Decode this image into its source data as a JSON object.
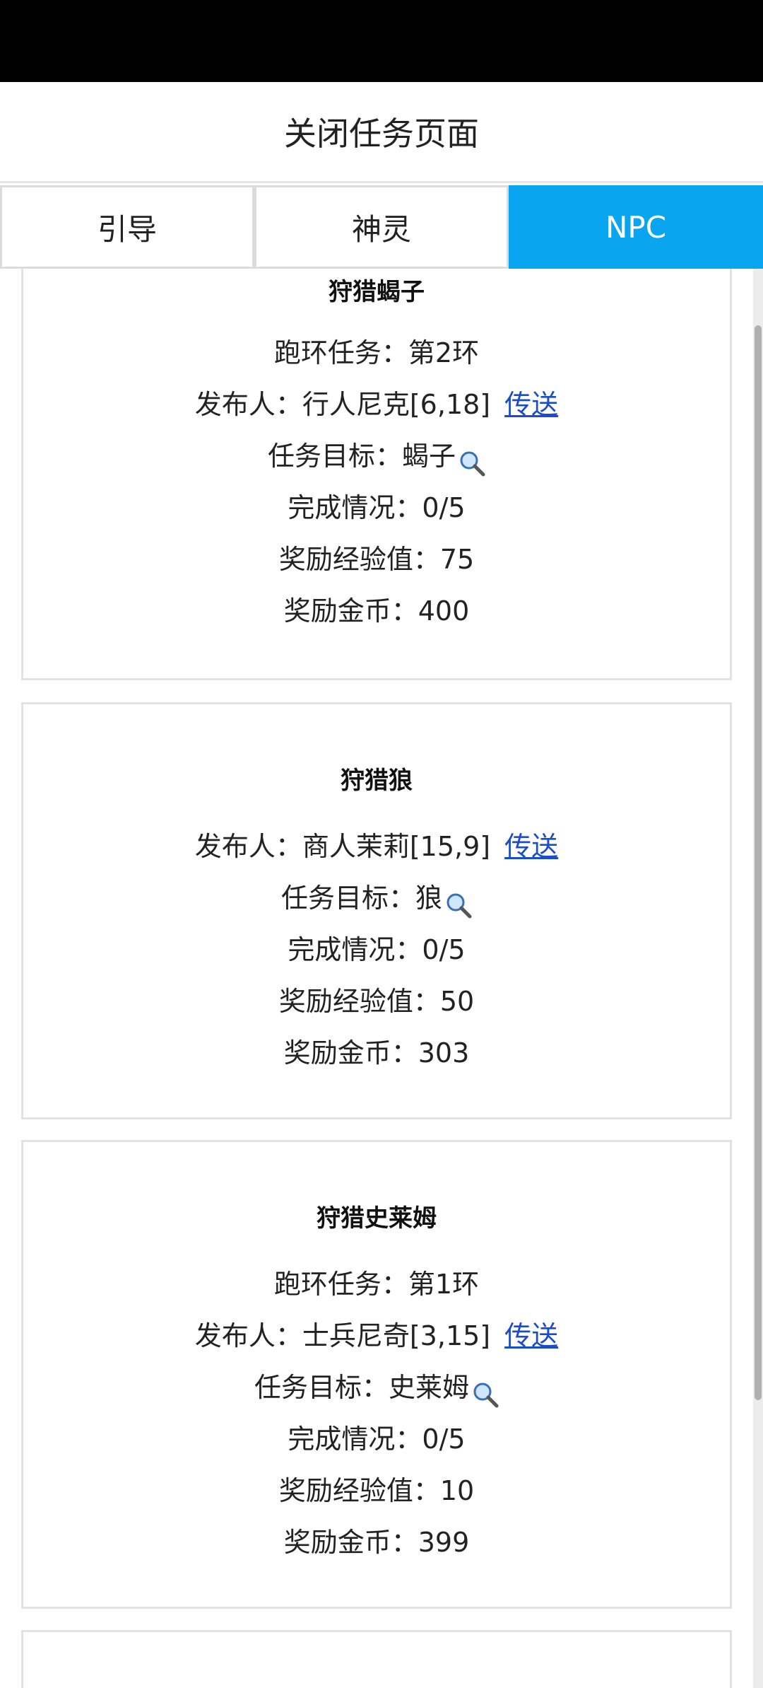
{
  "header": {
    "title": "关闭任务页面"
  },
  "tabs": [
    {
      "label": "引导",
      "active": false
    },
    {
      "label": "神灵",
      "active": false
    },
    {
      "label": "NPC",
      "active": true
    }
  ],
  "labels": {
    "loop": "跑环任务：",
    "publisher": "发布人：",
    "target": "任务目标：",
    "progress": "完成情况：",
    "exp": "奖励经验值：",
    "gold": "奖励金币：",
    "teleport": "传送"
  },
  "quests": [
    {
      "title": "狩猎蝎子",
      "loop": "第2环",
      "publisher": "行人尼克[6,18]",
      "target": "蝎子",
      "progress": "0/5",
      "exp": "75",
      "gold": "400"
    },
    {
      "title": "狩猎狼",
      "publisher": "商人茉莉[15,9]",
      "target": "狼",
      "progress": "0/5",
      "exp": "50",
      "gold": "303"
    },
    {
      "title": "狩猎史莱姆",
      "loop": "第1环",
      "publisher": "士兵尼奇[3,15]",
      "target": "史莱姆",
      "progress": "0/5",
      "exp": "10",
      "gold": "399"
    }
  ],
  "colors": {
    "active_tab": "#0aa5f0",
    "link": "#1a4dc7"
  }
}
